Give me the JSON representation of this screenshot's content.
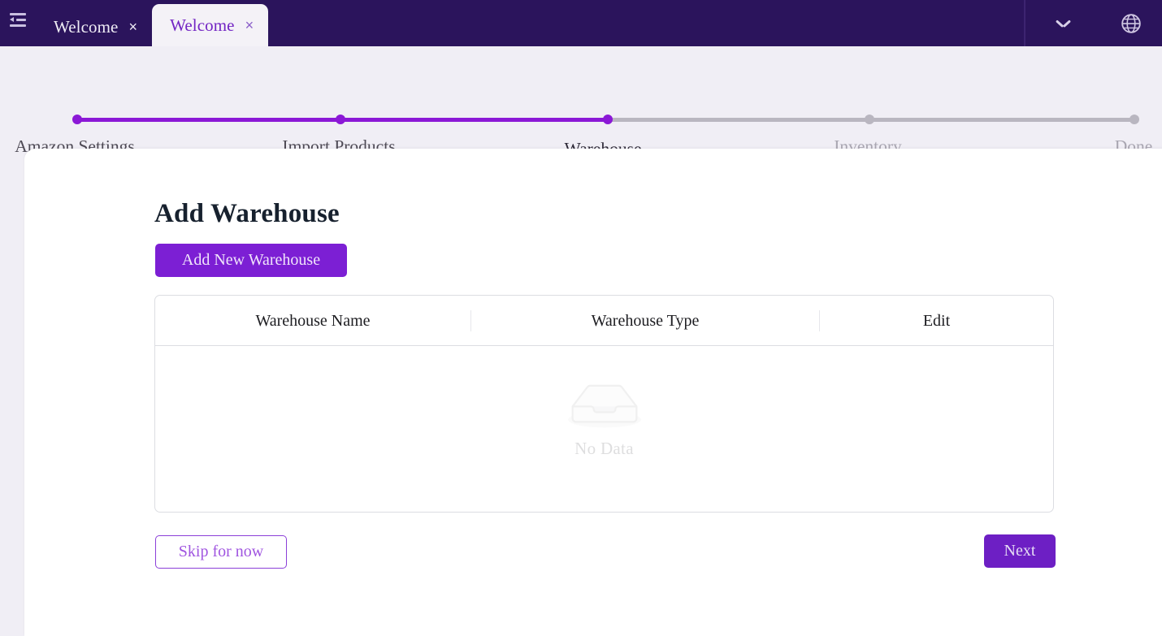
{
  "window": {
    "menu_icon": "menu-fold-icon",
    "chevron_icon": "chevron-down-icon",
    "globe_icon": "globe-icon",
    "tabs": [
      {
        "label": "Welcome",
        "close": "×",
        "active": false
      },
      {
        "label": "Welcome",
        "close": "×",
        "active": true
      }
    ]
  },
  "stepper": {
    "steps": [
      {
        "label": "Amazon Settings",
        "state": "done"
      },
      {
        "label": "Import Products",
        "state": "done"
      },
      {
        "label": "Warehouse",
        "state": "active"
      },
      {
        "label": "Inventory",
        "state": "todo"
      },
      {
        "label": "Done",
        "state": "todo"
      }
    ]
  },
  "main": {
    "title": "Add Warehouse",
    "add_button": "Add New Warehouse",
    "table": {
      "columns": [
        "Warehouse Name",
        "Warehouse Type",
        "Edit"
      ],
      "rows": [],
      "empty_text": "No Data",
      "empty_icon": "empty-box-icon"
    },
    "footer": {
      "skip_label": "Skip for now",
      "next_label": "Next"
    }
  },
  "colors": {
    "titlebar": "#2b145c",
    "page_bg": "#f0eef5",
    "accent": "#7c1fd4",
    "stepper_done": "#8b18d6",
    "stepper_todo": "#b9b6c0"
  }
}
